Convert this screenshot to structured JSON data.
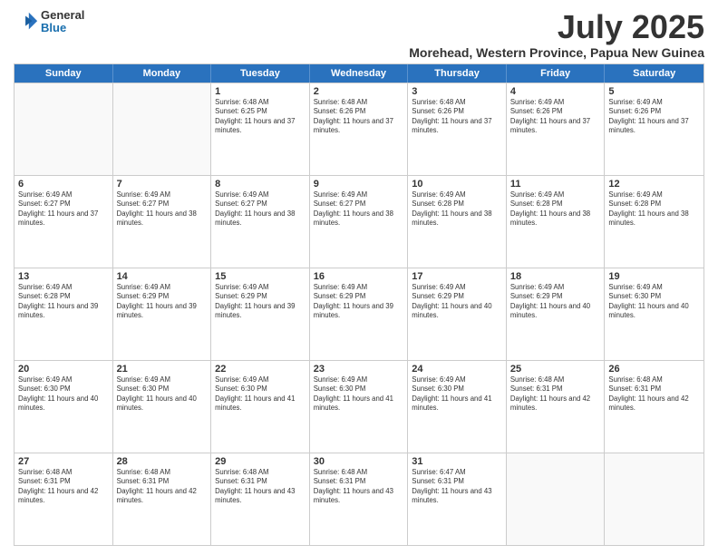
{
  "logo": {
    "general": "General",
    "blue": "Blue"
  },
  "title": "July 2025",
  "subtitle": "Morehead, Western Province, Papua New Guinea",
  "days_of_week": [
    "Sunday",
    "Monday",
    "Tuesday",
    "Wednesday",
    "Thursday",
    "Friday",
    "Saturday"
  ],
  "weeks": [
    [
      {
        "day": "",
        "text": ""
      },
      {
        "day": "",
        "text": ""
      },
      {
        "day": "1",
        "text": "Sunrise: 6:48 AM\nSunset: 6:25 PM\nDaylight: 11 hours and 37 minutes."
      },
      {
        "day": "2",
        "text": "Sunrise: 6:48 AM\nSunset: 6:26 PM\nDaylight: 11 hours and 37 minutes."
      },
      {
        "day": "3",
        "text": "Sunrise: 6:48 AM\nSunset: 6:26 PM\nDaylight: 11 hours and 37 minutes."
      },
      {
        "day": "4",
        "text": "Sunrise: 6:49 AM\nSunset: 6:26 PM\nDaylight: 11 hours and 37 minutes."
      },
      {
        "day": "5",
        "text": "Sunrise: 6:49 AM\nSunset: 6:26 PM\nDaylight: 11 hours and 37 minutes."
      }
    ],
    [
      {
        "day": "6",
        "text": "Sunrise: 6:49 AM\nSunset: 6:27 PM\nDaylight: 11 hours and 37 minutes."
      },
      {
        "day": "7",
        "text": "Sunrise: 6:49 AM\nSunset: 6:27 PM\nDaylight: 11 hours and 38 minutes."
      },
      {
        "day": "8",
        "text": "Sunrise: 6:49 AM\nSunset: 6:27 PM\nDaylight: 11 hours and 38 minutes."
      },
      {
        "day": "9",
        "text": "Sunrise: 6:49 AM\nSunset: 6:27 PM\nDaylight: 11 hours and 38 minutes."
      },
      {
        "day": "10",
        "text": "Sunrise: 6:49 AM\nSunset: 6:28 PM\nDaylight: 11 hours and 38 minutes."
      },
      {
        "day": "11",
        "text": "Sunrise: 6:49 AM\nSunset: 6:28 PM\nDaylight: 11 hours and 38 minutes."
      },
      {
        "day": "12",
        "text": "Sunrise: 6:49 AM\nSunset: 6:28 PM\nDaylight: 11 hours and 38 minutes."
      }
    ],
    [
      {
        "day": "13",
        "text": "Sunrise: 6:49 AM\nSunset: 6:28 PM\nDaylight: 11 hours and 39 minutes."
      },
      {
        "day": "14",
        "text": "Sunrise: 6:49 AM\nSunset: 6:29 PM\nDaylight: 11 hours and 39 minutes."
      },
      {
        "day": "15",
        "text": "Sunrise: 6:49 AM\nSunset: 6:29 PM\nDaylight: 11 hours and 39 minutes."
      },
      {
        "day": "16",
        "text": "Sunrise: 6:49 AM\nSunset: 6:29 PM\nDaylight: 11 hours and 39 minutes."
      },
      {
        "day": "17",
        "text": "Sunrise: 6:49 AM\nSunset: 6:29 PM\nDaylight: 11 hours and 40 minutes."
      },
      {
        "day": "18",
        "text": "Sunrise: 6:49 AM\nSunset: 6:29 PM\nDaylight: 11 hours and 40 minutes."
      },
      {
        "day": "19",
        "text": "Sunrise: 6:49 AM\nSunset: 6:30 PM\nDaylight: 11 hours and 40 minutes."
      }
    ],
    [
      {
        "day": "20",
        "text": "Sunrise: 6:49 AM\nSunset: 6:30 PM\nDaylight: 11 hours and 40 minutes."
      },
      {
        "day": "21",
        "text": "Sunrise: 6:49 AM\nSunset: 6:30 PM\nDaylight: 11 hours and 40 minutes."
      },
      {
        "day": "22",
        "text": "Sunrise: 6:49 AM\nSunset: 6:30 PM\nDaylight: 11 hours and 41 minutes."
      },
      {
        "day": "23",
        "text": "Sunrise: 6:49 AM\nSunset: 6:30 PM\nDaylight: 11 hours and 41 minutes."
      },
      {
        "day": "24",
        "text": "Sunrise: 6:49 AM\nSunset: 6:30 PM\nDaylight: 11 hours and 41 minutes."
      },
      {
        "day": "25",
        "text": "Sunrise: 6:48 AM\nSunset: 6:31 PM\nDaylight: 11 hours and 42 minutes."
      },
      {
        "day": "26",
        "text": "Sunrise: 6:48 AM\nSunset: 6:31 PM\nDaylight: 11 hours and 42 minutes."
      }
    ],
    [
      {
        "day": "27",
        "text": "Sunrise: 6:48 AM\nSunset: 6:31 PM\nDaylight: 11 hours and 42 minutes."
      },
      {
        "day": "28",
        "text": "Sunrise: 6:48 AM\nSunset: 6:31 PM\nDaylight: 11 hours and 42 minutes."
      },
      {
        "day": "29",
        "text": "Sunrise: 6:48 AM\nSunset: 6:31 PM\nDaylight: 11 hours and 43 minutes."
      },
      {
        "day": "30",
        "text": "Sunrise: 6:48 AM\nSunset: 6:31 PM\nDaylight: 11 hours and 43 minutes."
      },
      {
        "day": "31",
        "text": "Sunrise: 6:47 AM\nSunset: 6:31 PM\nDaylight: 11 hours and 43 minutes."
      },
      {
        "day": "",
        "text": ""
      },
      {
        "day": "",
        "text": ""
      }
    ]
  ]
}
